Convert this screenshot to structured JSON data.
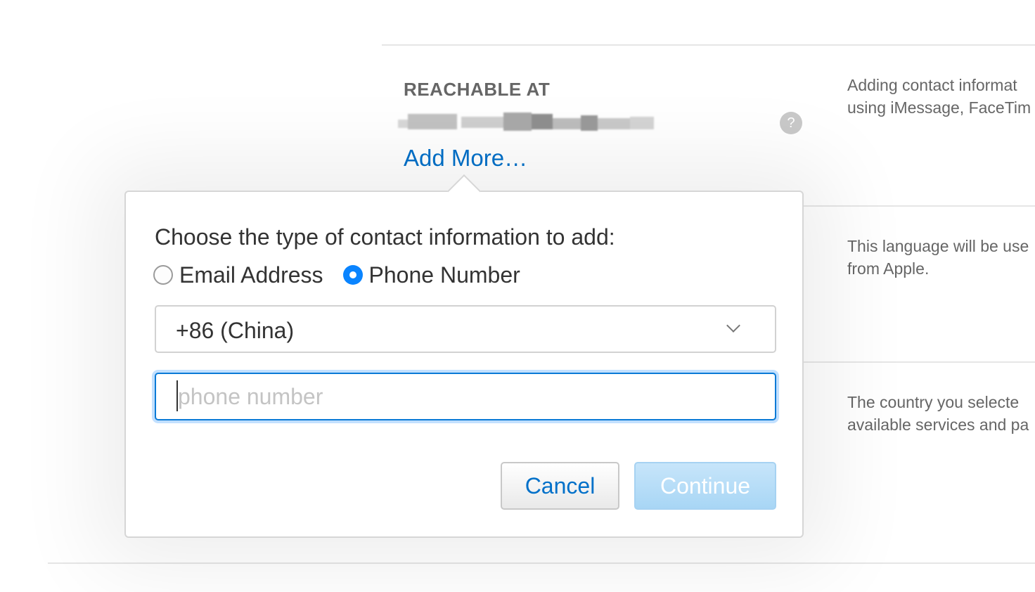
{
  "section": {
    "label": "REACHABLE AT",
    "add_more": "Add More…",
    "help_icon": "?"
  },
  "descriptions": {
    "reachable": [
      "Adding contact informat",
      "using iMessage, FaceTim"
    ],
    "language": [
      "This language will be use",
      "from Apple."
    ],
    "country": [
      "The country you selecte",
      "available services and pa"
    ]
  },
  "popover": {
    "prompt": "Choose the type of contact information to add:",
    "options": [
      {
        "label": "Email Address",
        "selected": false
      },
      {
        "label": "Phone Number",
        "selected": true
      }
    ],
    "country_code": "+86 (China)",
    "phone_placeholder": "phone number",
    "phone_value": "",
    "cancel_label": "Cancel",
    "continue_label": "Continue"
  },
  "colors": {
    "link": "#0070c9",
    "radio_selected": "#0a84ff",
    "continue_disabled": "#a8d6f5"
  }
}
